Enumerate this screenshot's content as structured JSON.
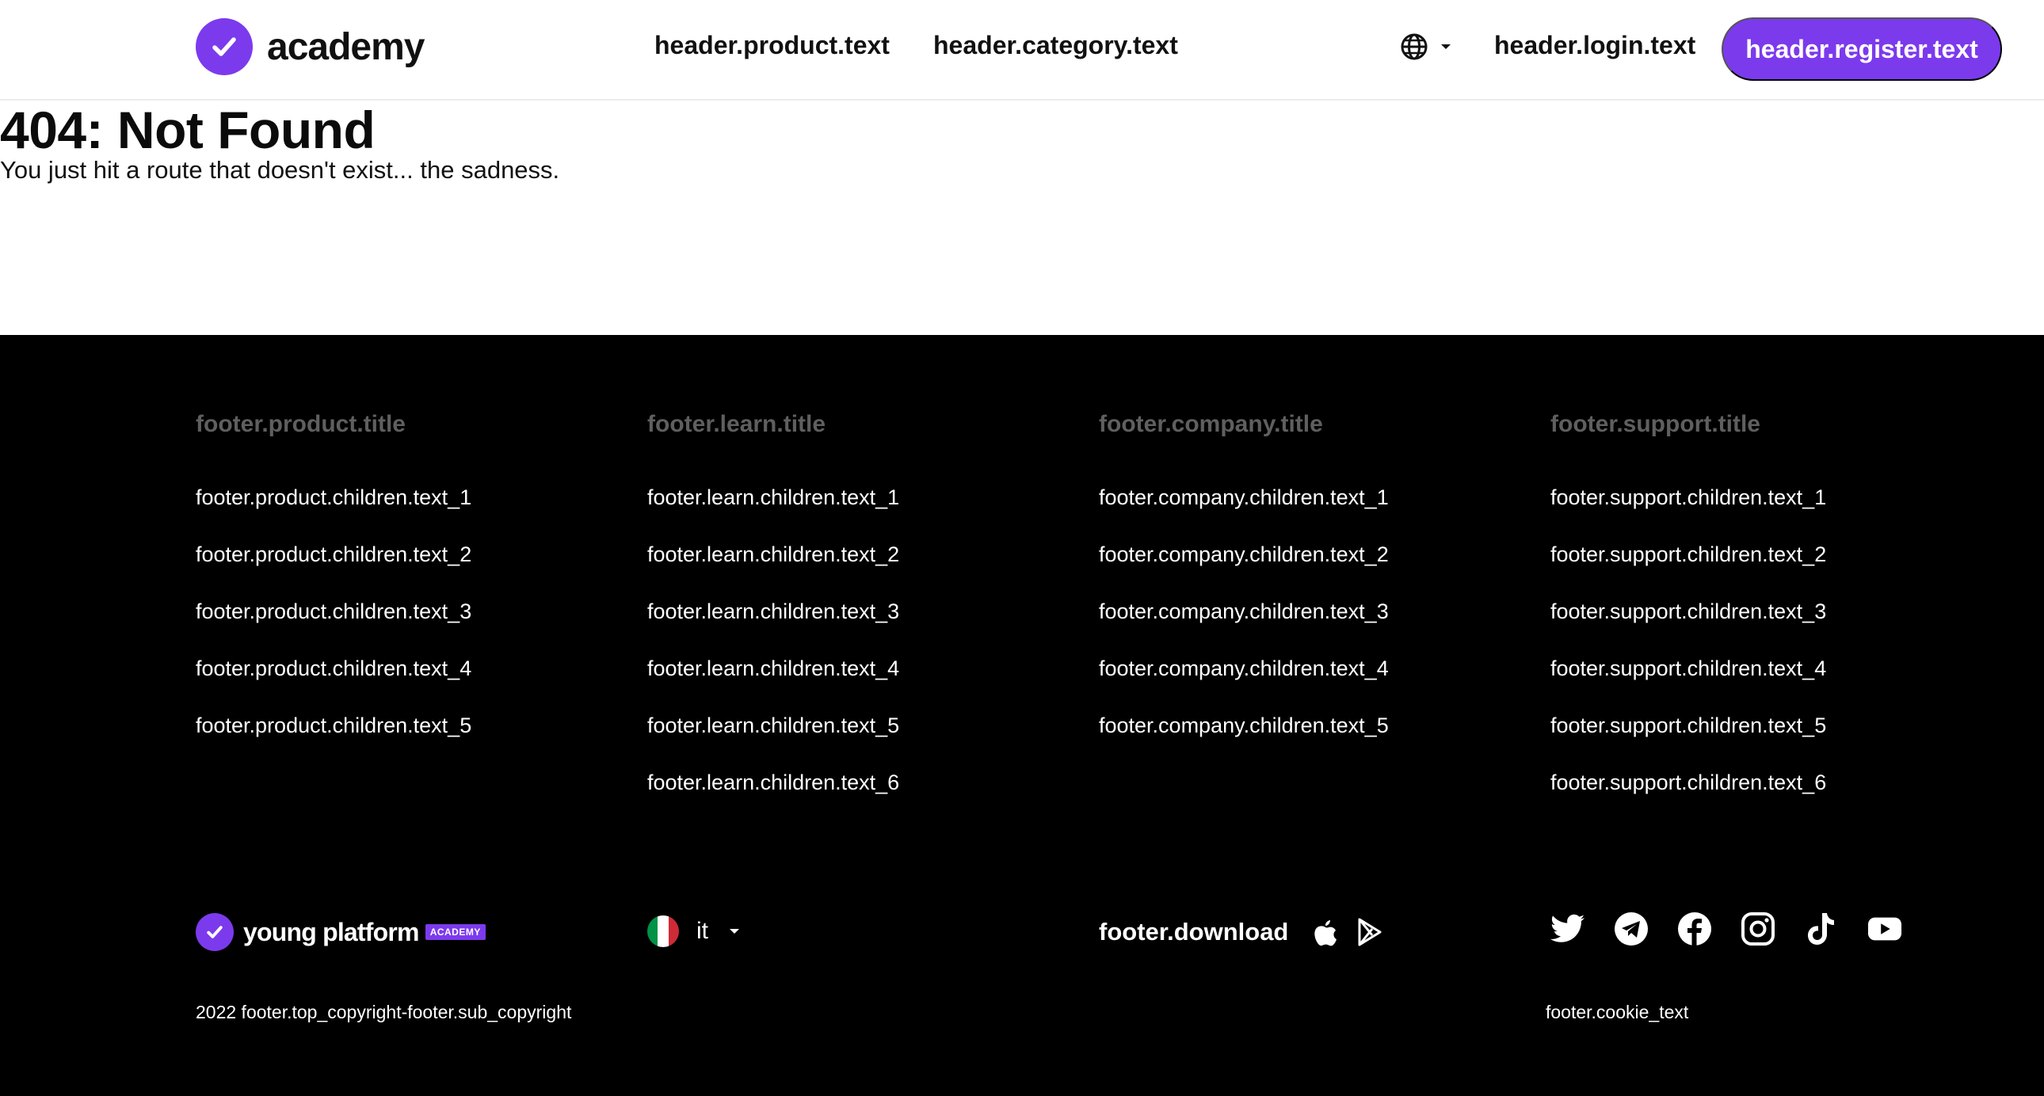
{
  "header": {
    "logo_text": "academy",
    "nav": {
      "product": "header.product.text",
      "category": "header.category.text"
    },
    "language_icon": "globe-icon",
    "login": "header.login.text",
    "register": "header.register.text"
  },
  "main": {
    "title": "404: Not Found",
    "subtitle": "You just hit a route that doesn't exist... the sadness."
  },
  "footer": {
    "columns": [
      {
        "title": "footer.product.title",
        "items": [
          "footer.product.children.text_1",
          "footer.product.children.text_2",
          "footer.product.children.text_3",
          "footer.product.children.text_4",
          "footer.product.children.text_5"
        ]
      },
      {
        "title": "footer.learn.title",
        "items": [
          "footer.learn.children.text_1",
          "footer.learn.children.text_2",
          "footer.learn.children.text_3",
          "footer.learn.children.text_4",
          "footer.learn.children.text_5",
          "footer.learn.children.text_6"
        ]
      },
      {
        "title": "footer.company.title",
        "items": [
          "footer.company.children.text_1",
          "footer.company.children.text_2",
          "footer.company.children.text_3",
          "footer.company.children.text_4",
          "footer.company.children.text_5"
        ]
      },
      {
        "title": "footer.support.title",
        "items": [
          "footer.support.children.text_1",
          "footer.support.children.text_2",
          "footer.support.children.text_3",
          "footer.support.children.text_4",
          "footer.support.children.text_5",
          "footer.support.children.text_6"
        ]
      }
    ],
    "brand": {
      "name": "young platform",
      "tag": "ACADEMY"
    },
    "language": {
      "code": "it",
      "flag_icon": "italy-flag-icon"
    },
    "download_label": "footer.download",
    "store_icons": [
      "apple-icon",
      "google-play-icon"
    ],
    "social_icons": [
      "twitter-icon",
      "telegram-icon",
      "facebook-icon",
      "instagram-icon",
      "tiktok-icon",
      "youtube-icon"
    ],
    "copyright": "2022 footer.top_copyright-footer.sub_copyright",
    "cookie": "footer.cookie_text"
  },
  "colors": {
    "brand": "#7c3aed",
    "footer_bg": "#000000",
    "footer_title": "#5f5f5f",
    "text": "#111111"
  }
}
